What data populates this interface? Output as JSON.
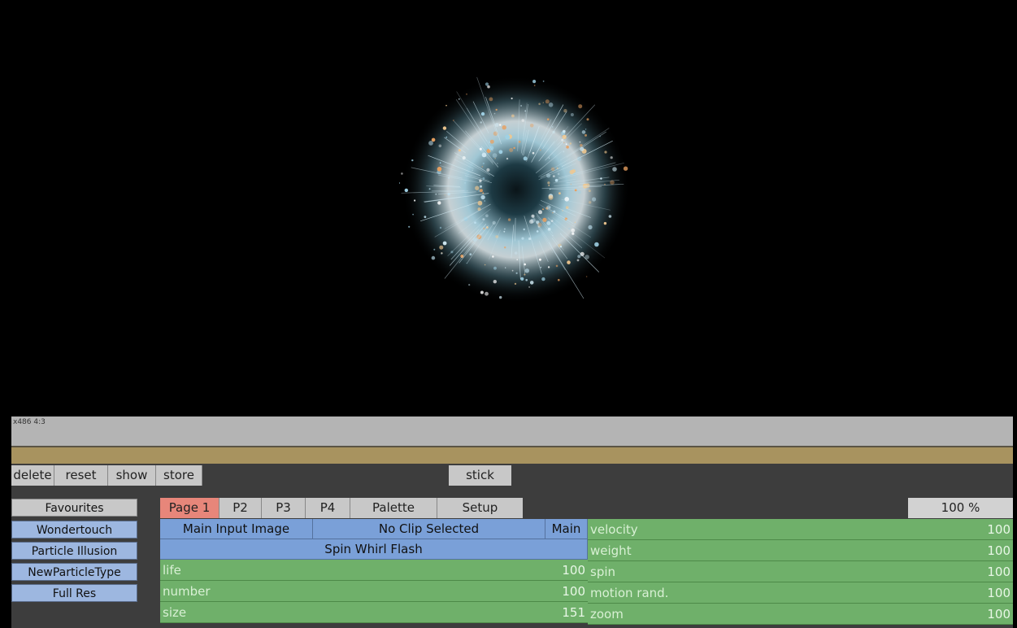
{
  "viewer": {
    "format_label": "x486 4:3"
  },
  "toolbar": {
    "delete": "delete",
    "reset": "reset",
    "show": "show",
    "store": "store",
    "stick": "stick"
  },
  "sidebar": {
    "items": [
      "Favourites",
      "Wondertouch",
      "Particle Illusion",
      "NewParticleType",
      "Full Res"
    ]
  },
  "tabs": [
    "Page 1",
    "P2",
    "P3",
    "P4",
    "Palette",
    "Setup"
  ],
  "zoom": "100 %",
  "source": {
    "input": "Main Input Image",
    "clip": "No Clip Selected",
    "mode": "Main",
    "emitter": "Spin Whirl Flash"
  },
  "params_left": [
    {
      "name": "life",
      "value": "100"
    },
    {
      "name": "number",
      "value": "100"
    },
    {
      "name": "size",
      "value": "151"
    }
  ],
  "params_right": [
    {
      "name": "velocity",
      "value": "100"
    },
    {
      "name": "weight",
      "value": "100"
    },
    {
      "name": "spin",
      "value": "100"
    },
    {
      "name": "motion rand.",
      "value": "100"
    },
    {
      "name": "zoom",
      "value": "100"
    }
  ],
  "colors": {
    "active_tab": "#e7867a",
    "blue_cell": "#7aa0d8",
    "green_param": "#6fb06a",
    "timeline": "#a8935f"
  }
}
